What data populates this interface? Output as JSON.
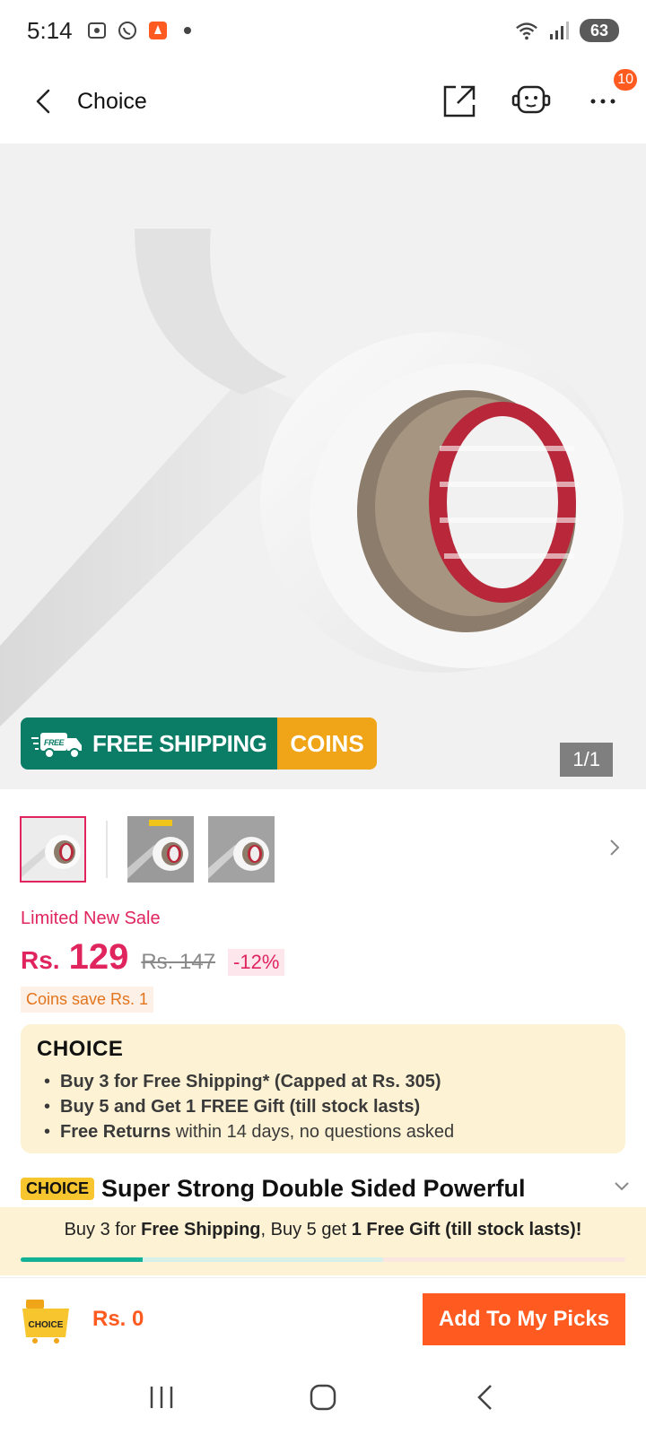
{
  "status_bar": {
    "time": "5:14",
    "battery": "63",
    "icons": [
      "screenshot-icon",
      "whatsapp-icon",
      "app-notification-icon",
      "dot-icon",
      "wifi-icon",
      "signal-icon"
    ]
  },
  "header": {
    "title": "Choice",
    "more_badge": "10",
    "icons": [
      "back-arrow-icon",
      "share-icon",
      "support-icon",
      "more-icon"
    ]
  },
  "gallery": {
    "shipping_left": "FREE SHIPPING",
    "shipping_badge": "FREE",
    "shipping_right": "COINS",
    "counter": "1/1",
    "thumbnails": 3
  },
  "price": {
    "label": "Limited New Sale",
    "currency": "Rs.",
    "value": "129",
    "old_price": "Rs. 147",
    "discount": "-12%",
    "coins_save": "Coins save Rs. 1"
  },
  "choice_box": {
    "logo": "CHOICE",
    "item1_bold": "Buy 3 for  Free Shipping* (Capped at Rs. 305)",
    "item2_bold": "Buy 5 and Get 1 FREE Gift (till stock lasts)",
    "item3_bold": "Free Returns",
    "item3_rest": " within 14 days, no questions asked"
  },
  "product": {
    "tag": "CHOICE",
    "title": "Super Strong Double Sided Powerful"
  },
  "promo": {
    "p1": "Buy 3 for ",
    "p2": "Free Shipping",
    "p3": ", Buy 5 get ",
    "p4": "1 Free Gift (till stock lasts)!",
    "progress_fraction": 0.2
  },
  "bottom_bar": {
    "cart_label": "CHOICE",
    "total": "Rs. 0",
    "cta": "Add To My Picks"
  },
  "colors": {
    "accent": "#ff5a1f",
    "price": "#e0245e",
    "shipping_green": "#0b7c66",
    "coins_orange": "#f0a518",
    "choice_bg": "#fdf2d3"
  }
}
